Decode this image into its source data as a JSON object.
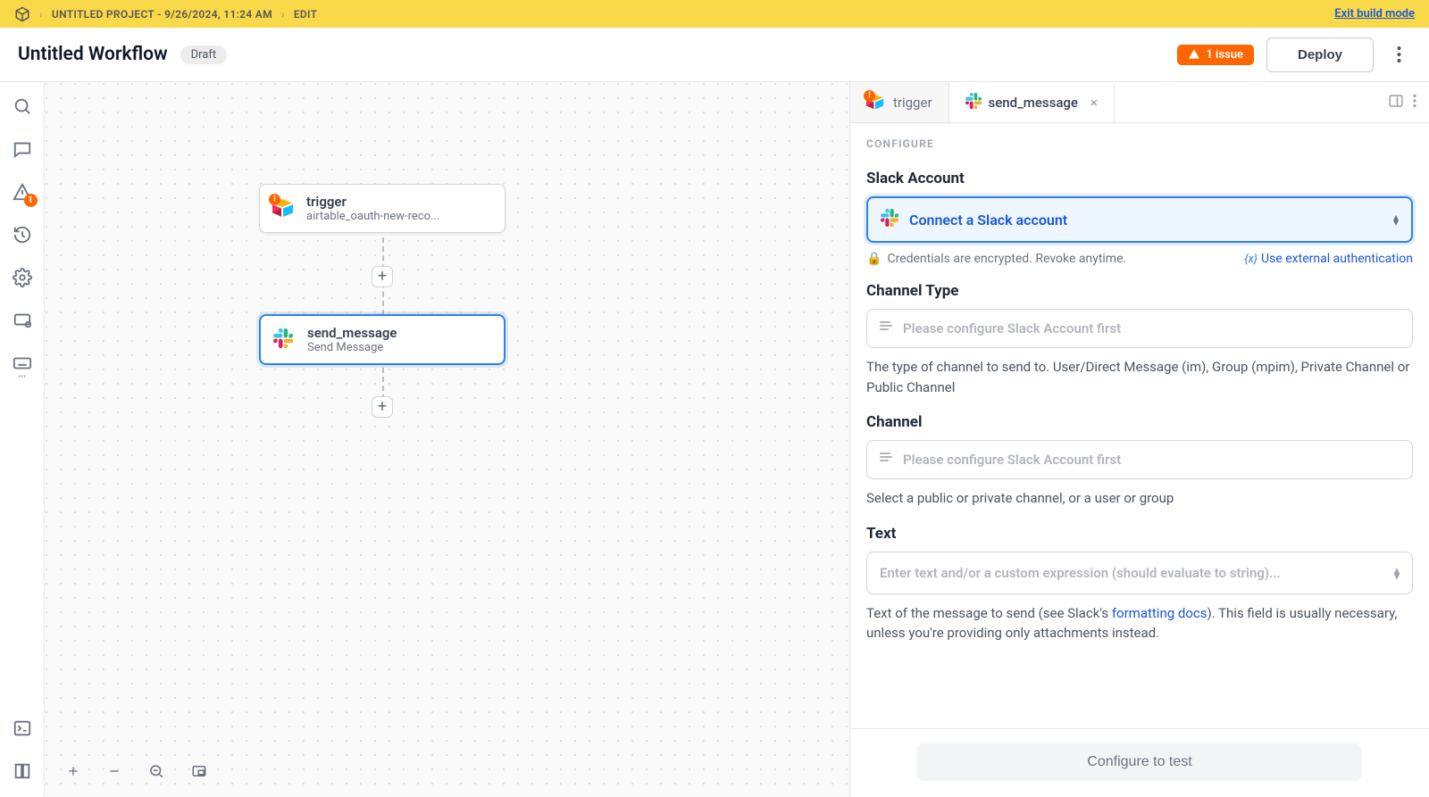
{
  "topbar": {
    "project_label": "UNTITLED PROJECT - 9/26/2024, 11:24 AM",
    "crumb_edit": "EDIT",
    "exit_link": "Exit build mode"
  },
  "title": {
    "workflow_name": "Untitled Workflow",
    "badge": "Draft",
    "issue_label": "1 issue",
    "deploy_label": "Deploy"
  },
  "leftrail": {
    "issue_count": "1"
  },
  "canvas": {
    "nodes": {
      "trigger": {
        "title": "trigger",
        "subtitle": "airtable_oauth-new-reco..."
      },
      "send_message": {
        "title": "send_message",
        "subtitle": "Send Message"
      }
    }
  },
  "rightpanel": {
    "tabs": {
      "trigger": "trigger",
      "send_message": "send_message"
    },
    "section_label": "CONFIGURE",
    "slack_account": {
      "label": "Slack Account",
      "connect_label": "Connect a Slack account",
      "hint": "Credentials are encrypted. Revoke anytime.",
      "external_link": "Use external authentication"
    },
    "channel_type": {
      "label": "Channel Type",
      "placeholder": "Please configure Slack Account first",
      "desc": "The type of channel to send to. User/Direct Message (im), Group (mpim), Private Channel or Public Channel"
    },
    "channel": {
      "label": "Channel",
      "placeholder": "Please configure Slack Account first",
      "desc": "Select a public or private channel, or a user or group"
    },
    "text_field": {
      "label": "Text",
      "placeholder": "Enter text and/or a custom expression (should evaluate to string)...",
      "desc_before": "Text of the message to send (see Slack's ",
      "desc_link": "formatting docs",
      "desc_after": "). This field is usually necessary, unless you're providing only attachments instead."
    },
    "footer_button": "Configure to test"
  }
}
